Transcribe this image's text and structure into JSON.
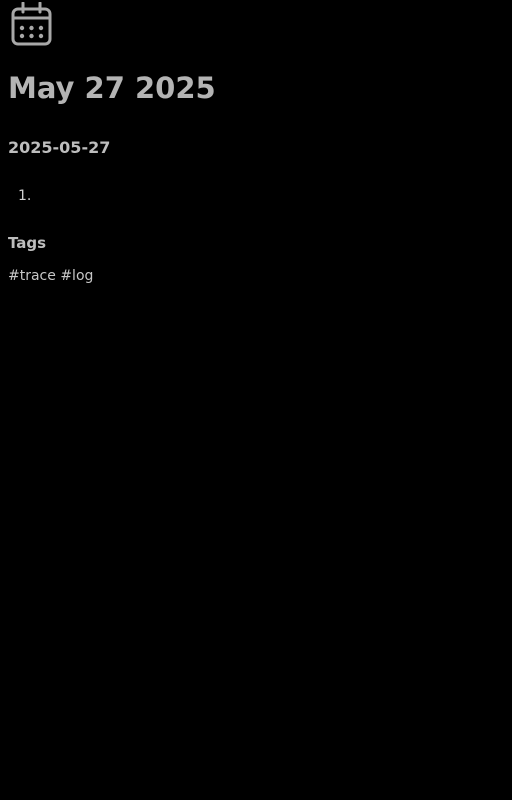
{
  "header": {
    "icon": "calendar-icon",
    "title": "May 27 2025"
  },
  "entry": {
    "date": "2025-05-27",
    "items": [
      {
        "number": "1.",
        "text": ""
      }
    ]
  },
  "tags": {
    "heading": "Tags",
    "items": [
      "#trace",
      "#log"
    ]
  },
  "colors": {
    "background": "#000000",
    "text": "#c8c8c8",
    "title": "#b4b4b4"
  }
}
